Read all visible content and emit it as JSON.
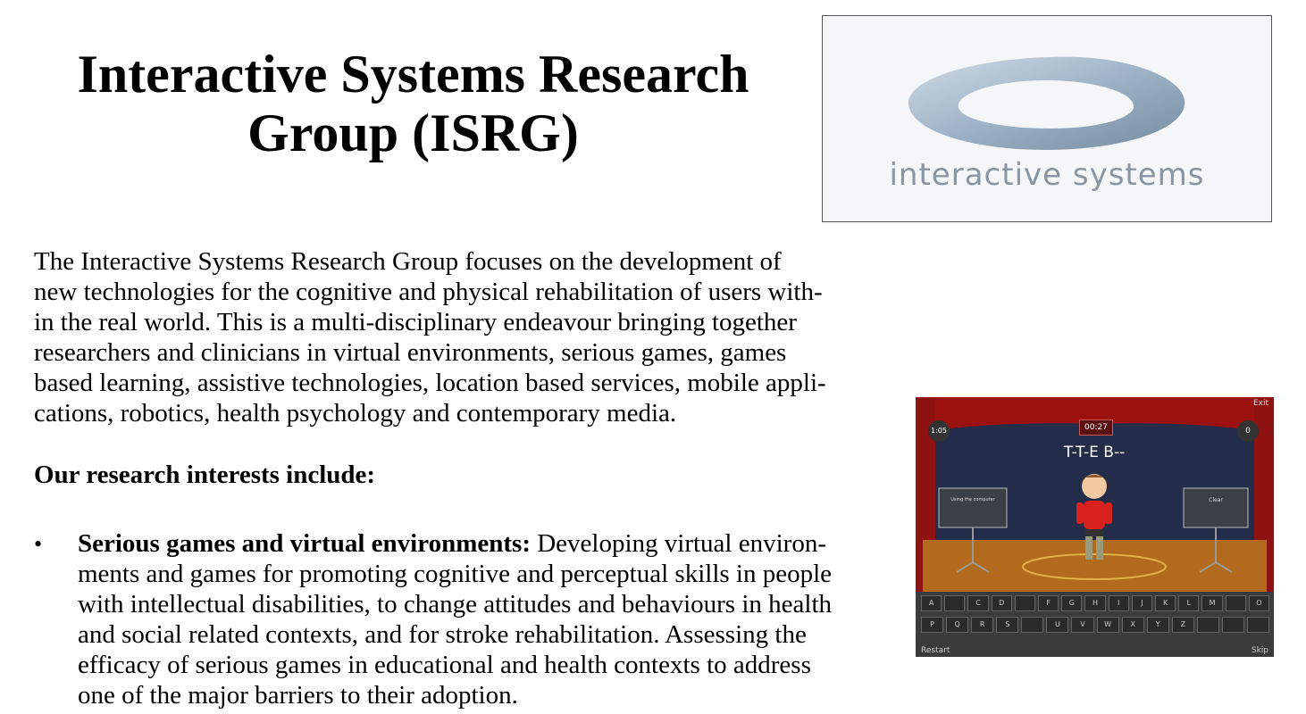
{
  "page": {
    "title_line1": "Interactive Systems Research",
    "title_line2": "Group (ISRG)"
  },
  "logo": {
    "text": "interactive systems"
  },
  "intro": {
    "lines": [
      "The Interactive Systems Research Group focuses on the development of",
      "new technologies for the cognitive and physical rehabilitation of users with-",
      "in the real world. This is a multi-disciplinary endeavour bringing together",
      "researchers and clinicians in virtual environments, serious games, games",
      "based learning, assistive technologies, location based services, mobile appli-",
      "cations, robotics, health psychology and contemporary media."
    ]
  },
  "research": {
    "heading": "Our research interests include:",
    "bullet_symbol": "•",
    "item1": {
      "term": "Serious games and virtual environments:",
      "lines": [
        "Developing virtual environ-",
        "ments and games for promoting cognitive and perceptual skills in people",
        "with intellectual disabilities, to change attitudes and behaviours in health",
        "and social related contexts, and for stroke rehabilitation. Assessing the",
        "efficacy of serious games in educational and health contexts to address",
        "one of the major barriers to their adoption."
      ]
    }
  },
  "game_screenshot": {
    "exit": "Exit",
    "timer_left": "1:05",
    "timer_center": "00:27",
    "score_right": "0",
    "word": "T-T-E B--",
    "sign_left": "Using the computer",
    "sign_right": "Clear",
    "keys_row1": [
      "A",
      "",
      "C",
      "D",
      "",
      "F",
      "G",
      "H",
      "I",
      "J",
      "K",
      "L",
      "M",
      "",
      "O"
    ],
    "keys_row2": [
      "P",
      "Q",
      "R",
      "S",
      "",
      "U",
      "V",
      "W",
      "X",
      "Y",
      "Z",
      "",
      "",
      ""
    ],
    "restart": "Restart",
    "skip": "Skip"
  }
}
